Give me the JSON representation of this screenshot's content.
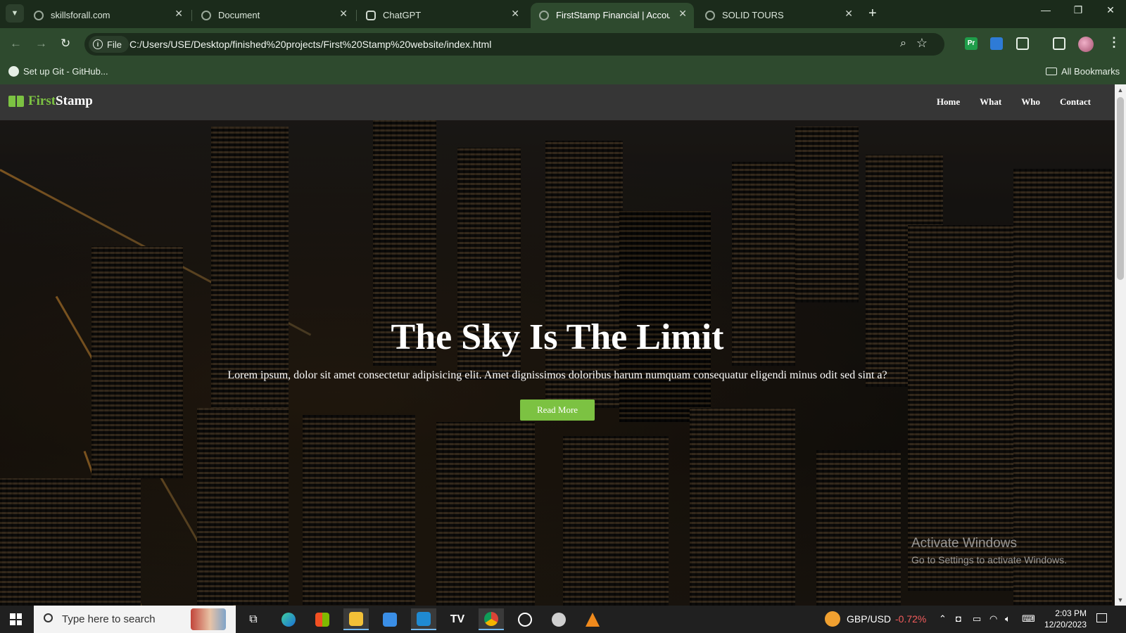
{
  "browser": {
    "tabs": [
      {
        "title": "skillsforall.com",
        "active": false
      },
      {
        "title": "Document",
        "active": false
      },
      {
        "title": "ChatGPT",
        "active": false
      },
      {
        "title": "FirstStamp Financial | Accountin",
        "active": true
      },
      {
        "title": "SOLID TOURS",
        "active": false
      }
    ],
    "new_tab": "+",
    "site_chip": "File",
    "url": "C:/Users/USE/Desktop/finished%20projects/First%20Stamp%20website/index.html",
    "bookmarks": {
      "left": "Set up Git - GitHub...",
      "right": "All Bookmarks"
    },
    "extension_pr": "Pr",
    "accent": "#2e4a2e"
  },
  "site": {
    "brand_first": "First",
    "brand_second": "Stamp",
    "nav": [
      "Home",
      "What",
      "Who",
      "Contact"
    ],
    "hero": {
      "title": "The Sky Is The Limit",
      "text": "Lorem ipsum, dolor sit amet consectetur adipisicing elit. Amet dignissimos doloribus harum numquam consequatur eligendi minus odit sed sint a?",
      "button": "Read More"
    },
    "brand_color": "#7cc242"
  },
  "watermark": {
    "line1": "Activate Windows",
    "line2": "Go to Settings to activate Windows."
  },
  "taskbar": {
    "search_placeholder": "Type here to search",
    "ticker_name": "GBP/USD",
    "ticker_value": "-0.72%",
    "time": "2:03 PM",
    "date": "12/20/2023"
  }
}
